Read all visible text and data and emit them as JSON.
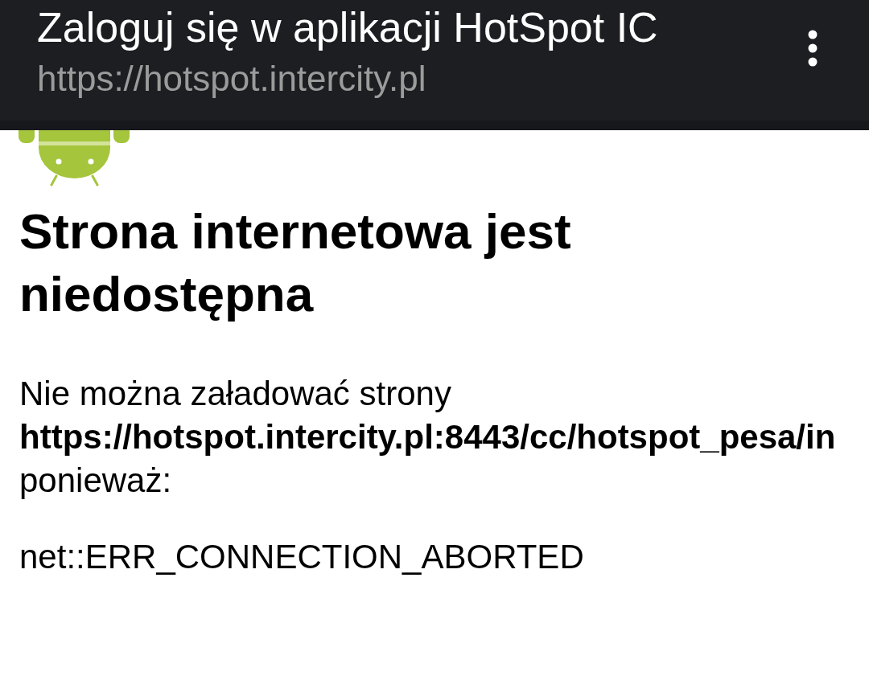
{
  "app_bar": {
    "title": "Zaloguj się w aplikacji HotSpot IC",
    "url": "https://hotspot.intercity.pl"
  },
  "page": {
    "heading": "Strona internetowa jest niedostępna",
    "message": "Nie można załadować strony **https://hotspot.intercity.pl:8443/cc/hotspot_pesa/in** ponieważ:",
    "error_code": "net::ERR_CONNECTION_ABORTED"
  }
}
